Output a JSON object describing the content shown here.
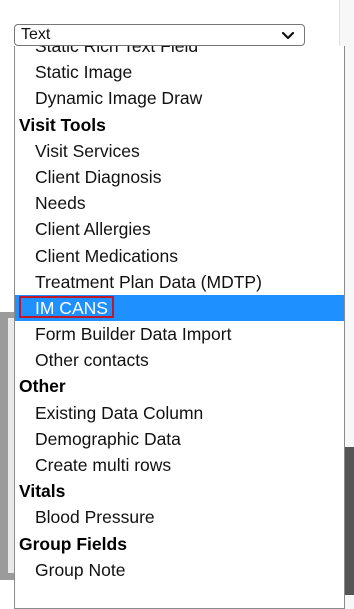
{
  "select": {
    "value": "Text",
    "icon": "chevron-down-icon"
  },
  "options": [
    {
      "kind": "option",
      "label": "Static Rich Text Field"
    },
    {
      "kind": "option",
      "label": "Static Image"
    },
    {
      "kind": "option",
      "label": "Dynamic Image Draw"
    },
    {
      "kind": "group",
      "label": "Visit Tools"
    },
    {
      "kind": "option",
      "label": "Visit Services"
    },
    {
      "kind": "option",
      "label": "Client Diagnosis"
    },
    {
      "kind": "option",
      "label": "Needs"
    },
    {
      "kind": "option",
      "label": "Client Allergies"
    },
    {
      "kind": "option",
      "label": "Client Medications"
    },
    {
      "kind": "option",
      "label": "Treatment Plan Data (MDTP)"
    },
    {
      "kind": "option",
      "label": "IM CANS",
      "selected": true,
      "annotated": true
    },
    {
      "kind": "option",
      "label": "Form Builder Data Import"
    },
    {
      "kind": "option",
      "label": "Other contacts"
    },
    {
      "kind": "group",
      "label": "Other"
    },
    {
      "kind": "option",
      "label": "Existing Data Column"
    },
    {
      "kind": "option",
      "label": "Demographic Data"
    },
    {
      "kind": "option",
      "label": "Create multi rows"
    },
    {
      "kind": "group",
      "label": "Vitals"
    },
    {
      "kind": "option",
      "label": "Blood Pressure"
    },
    {
      "kind": "group",
      "label": "Group Fields"
    },
    {
      "kind": "option",
      "label": "Group Note"
    }
  ],
  "colors": {
    "selected_bg": "#1e90ff",
    "annotation_border": "#c0182a"
  }
}
